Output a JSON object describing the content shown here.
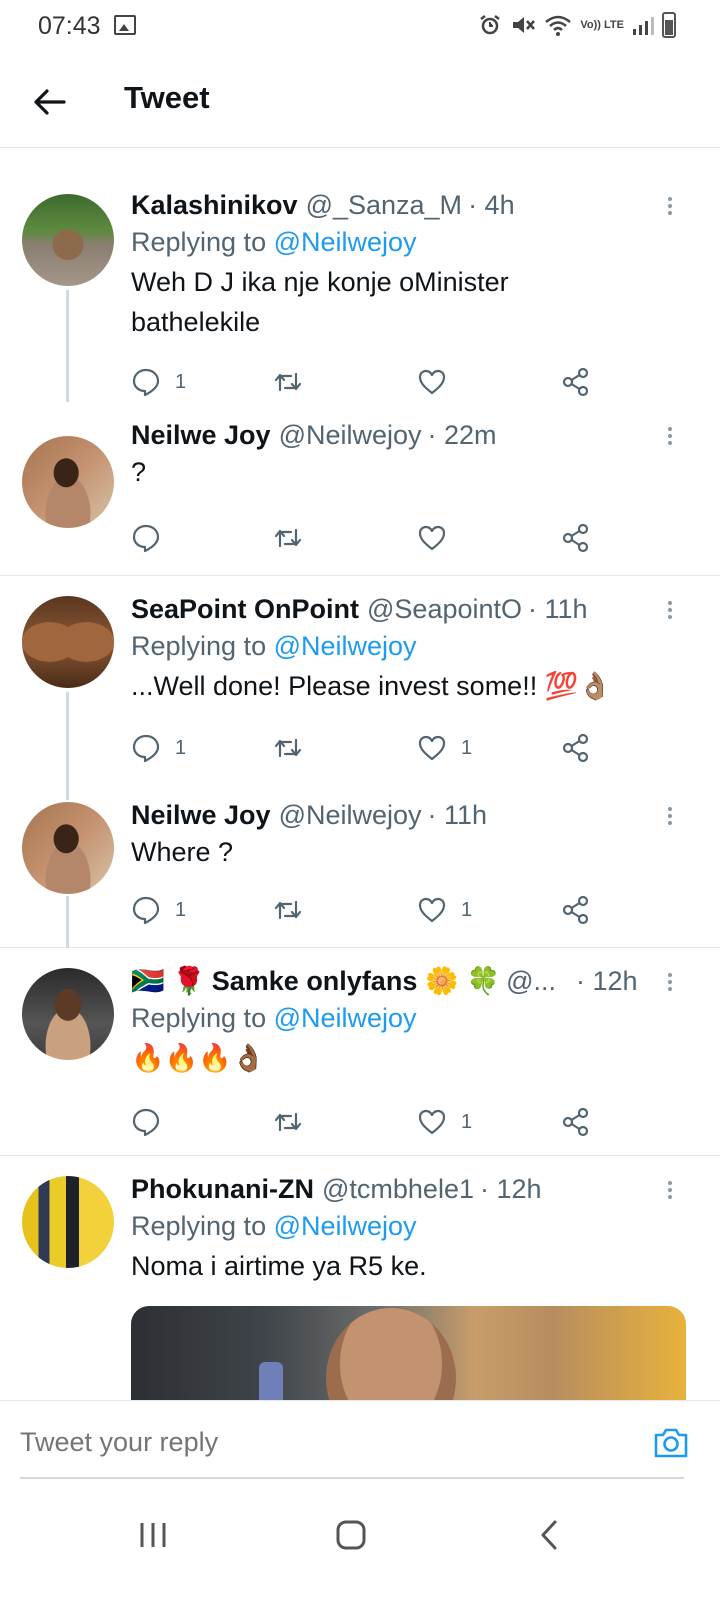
{
  "status_bar": {
    "time": "07:43",
    "network": "Vo)) LTE"
  },
  "header": {
    "title": "Tweet"
  },
  "colors": {
    "accent": "#1d9bf0",
    "text": "#0f1419",
    "muted": "#536471"
  },
  "tweets": [
    {
      "name": "Kalashinikov",
      "handle": "@_Sanza_M",
      "time": "· 4h",
      "replying_label": "Replying to",
      "replying_to": "@Neilwejoy",
      "text_lines": [
        "Weh D J ika nje konje oMinister",
        "bathelekile"
      ],
      "reply_count": "1",
      "retweet_count": "",
      "like_count": ""
    },
    {
      "name": "Neilwe Joy",
      "handle": "@Neilwejoy",
      "time": "· 22m",
      "text_lines": [
        "?"
      ],
      "reply_count": "",
      "retweet_count": "",
      "like_count": ""
    },
    {
      "name": "SeaPoint OnPoint",
      "handle": "@SeapointO",
      "time": "· 11h",
      "replying_label": "Replying to",
      "replying_to": "@Neilwejoy",
      "text_lines": [
        "...Well done! Please invest some!! 💯👌🏽"
      ],
      "reply_count": "1",
      "retweet_count": "",
      "like_count": "1"
    },
    {
      "name": "Neilwe Joy",
      "handle": "@Neilwejoy",
      "time": "· 11h",
      "text_lines": [
        "Where ?"
      ],
      "reply_count": "1",
      "retweet_count": "",
      "like_count": "1"
    },
    {
      "name_prefix": "🇿🇦 🌹",
      "name": "Samke onlyfans",
      "name_suffix": "🌼 🍀",
      "handle": "@...",
      "time": "· 12h",
      "replying_label": "Replying to",
      "replying_to": "@Neilwejoy",
      "text_lines": [
        "🔥🔥🔥👌🏾"
      ],
      "reply_count": "",
      "retweet_count": "",
      "like_count": "1"
    },
    {
      "name": "Phokunani-ZN",
      "handle": "@tcmbhele1",
      "time": "· 12h",
      "replying_label": "Replying to",
      "replying_to": "@Neilwejoy",
      "text_lines": [
        "Noma i airtime ya R5 ke."
      ],
      "reply_count": "",
      "retweet_count": "",
      "like_count": ""
    }
  ],
  "compose": {
    "placeholder": "Tweet your reply"
  },
  "icons": {
    "back": "arrow-left-icon",
    "reply": "comment-icon",
    "retweet": "retweet-icon",
    "like": "heart-icon",
    "share": "share-icon",
    "camera": "camera-icon",
    "more": "more-vertical-icon"
  }
}
